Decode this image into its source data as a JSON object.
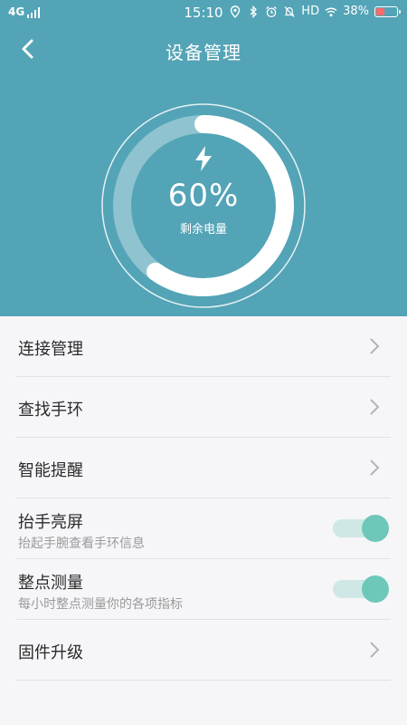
{
  "status_bar": {
    "network": "4G",
    "time": "15:10",
    "hd": "HD",
    "battery": "38%",
    "battery_level": 0.38,
    "icons": [
      "location-icon",
      "bluetooth-icon",
      "alarm-icon",
      "mute-icon",
      "wifi-icon",
      "battery-icon"
    ]
  },
  "nav": {
    "title": "设备管理",
    "back_icon": "back-arrow-icon"
  },
  "battery_gauge": {
    "percent_text": "60%",
    "percent_value": 60,
    "label": "剩余电量",
    "icon": "lightning-icon"
  },
  "colors": {
    "header_bg": "#53a4b6",
    "toggle_on": "#6ec8ba",
    "toggle_track": "#cfe8e5",
    "battery_low": "#ff6b6b"
  },
  "menu": {
    "connection": {
      "label": "连接管理"
    },
    "find_band": {
      "label": "查找手环"
    },
    "smart_reminder": {
      "label": "智能提醒"
    },
    "raise_to_wake": {
      "label": "抬手亮屏",
      "sub": "抬起手腕查看手环信息",
      "enabled": true
    },
    "hourly_measure": {
      "label": "整点测量",
      "sub": "每小时整点测量你的各项指标",
      "enabled": true
    },
    "firmware": {
      "label": "固件升级"
    }
  }
}
